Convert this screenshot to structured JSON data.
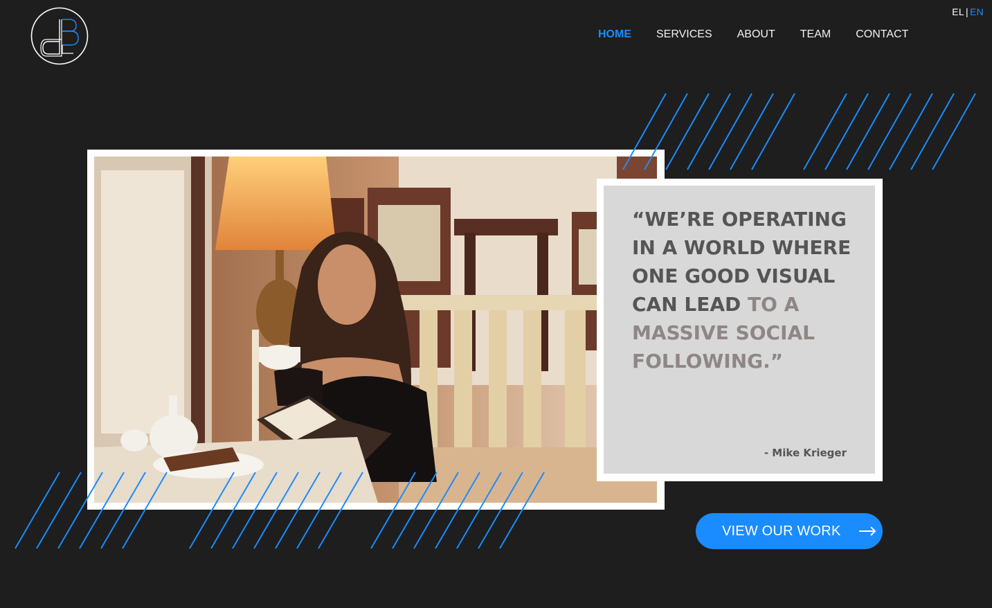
{
  "header": {
    "logo_name": "db-monogram-logo",
    "nav": [
      {
        "label": "HOME",
        "active": true
      },
      {
        "label": "SERVICES",
        "active": false
      },
      {
        "label": "ABOUT",
        "active": false
      },
      {
        "label": "TEAM",
        "active": false
      },
      {
        "label": "CONTACT",
        "active": false
      }
    ],
    "lang": {
      "el": "EL",
      "separator": "|",
      "en": "EN",
      "active": "EN"
    }
  },
  "hero": {
    "image_subject": "woman reading a book while drinking coffee in a cafe",
    "quote": {
      "part1": "“WE’RE OPERATING IN A WORLD WHERE ONE GOOD VISUAL CAN LEAD",
      "part2": "TO A MASSIVE SOCIAL FOLLOWING.”",
      "author": "- Mike Krieger"
    },
    "cta": {
      "label": "VIEW OUR WORK",
      "icon": "arrow-right-icon"
    }
  },
  "colors": {
    "background": "#1e1e1e",
    "accent": "#1a8cff",
    "card": "#d8d8d8",
    "quote_dark": "#555555",
    "quote_muted": "#8f8686"
  }
}
